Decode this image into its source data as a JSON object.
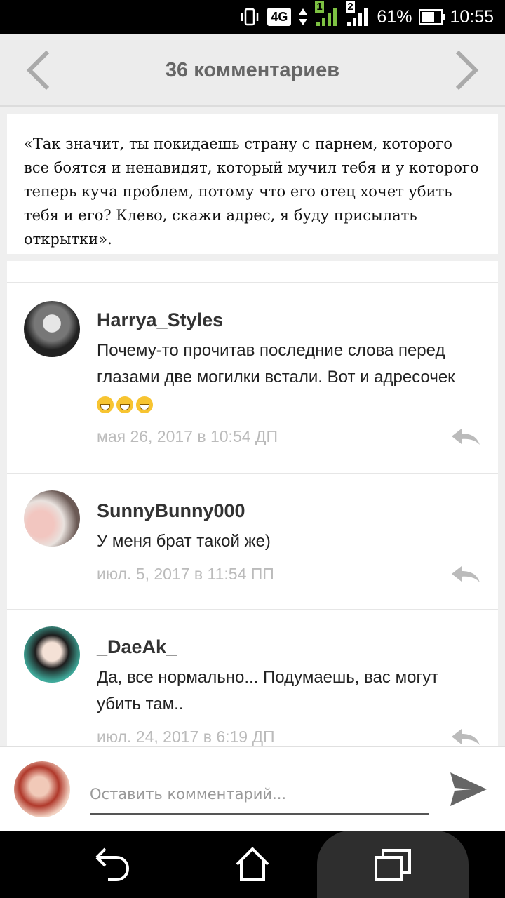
{
  "status_bar": {
    "signal_1": "1",
    "signal_2": "2",
    "network": "4G",
    "battery": "61%",
    "time": "10:55",
    "icons": [
      "vibrate-icon",
      "data-arrows-icon",
      "signal-icon",
      "battery-icon"
    ]
  },
  "header": {
    "title": "36 комментариев",
    "prev_icon": "chevron-left-icon",
    "next_icon": "chevron-right-icon"
  },
  "quote": {
    "text": "«Так значит, ты покидаешь страну с парнем, которого все боятся и ненавидят, который мучил тебя и у которого теперь куча проблем, потому что его отец хочет убить тебя и его? Клево, скажи адрес, я буду присылать открытки»."
  },
  "comments": [
    {
      "author": "Harrya_Styles",
      "text": "Почему-то прочитав последние слова перед глазами две могилки встали. Вот и адресочек",
      "emoji": "grinning-emoji x3",
      "date": "мая 26, 2017 в 10:54 ДП"
    },
    {
      "author": "SunnyBunny000",
      "text": "У меня брат такой же)",
      "date": "июл. 5, 2017 в 11:54 ПП"
    },
    {
      "author": "_DaeAk_",
      "text": "Да, все нормально... Подумаешь, вас могут убить там..",
      "date": "июл. 24, 2017 в 6:19 ДП"
    }
  ],
  "input": {
    "placeholder": "Оставить комментарий..."
  },
  "colors": {
    "header_bg": "#ececec",
    "title": "#666666",
    "date": "#bbbbbb",
    "accent": "#555555"
  }
}
